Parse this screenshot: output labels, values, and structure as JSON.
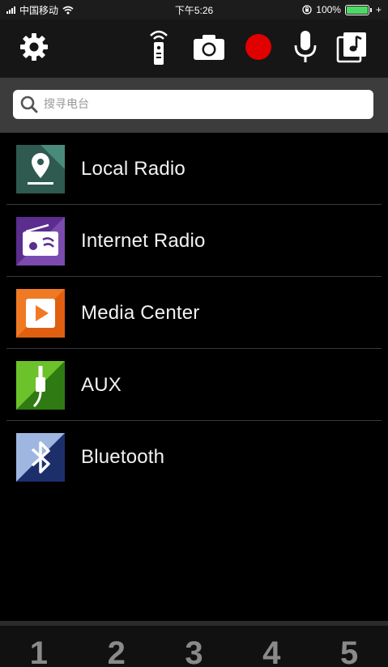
{
  "status_bar": {
    "carrier": "中国移动",
    "time": "下午5:26",
    "battery_percent": "100%",
    "battery_level": 1.0
  },
  "toolbar": {
    "icons": [
      "gear-icon",
      "remote-icon",
      "camera-icon",
      "record-icon",
      "microphone-icon",
      "music-library-icon"
    ],
    "record_color": "#e00000"
  },
  "search": {
    "placeholder": "搜寻电台"
  },
  "sources": [
    {
      "label": "Local Radio",
      "icon": "location-pin-icon",
      "color": "#2e5a50"
    },
    {
      "label": "Internet Radio",
      "icon": "radio-icon",
      "color": "#5b2d8e"
    },
    {
      "label": "Media Center",
      "icon": "play-icon",
      "color": "#f07a24"
    },
    {
      "label": "AUX",
      "icon": "aux-plug-icon",
      "color": "#4a9a1e"
    },
    {
      "label": "Bluetooth",
      "icon": "bluetooth-icon",
      "color": "#1d2f6b"
    }
  ],
  "presets": [
    "1",
    "2",
    "3",
    "4",
    "5"
  ]
}
